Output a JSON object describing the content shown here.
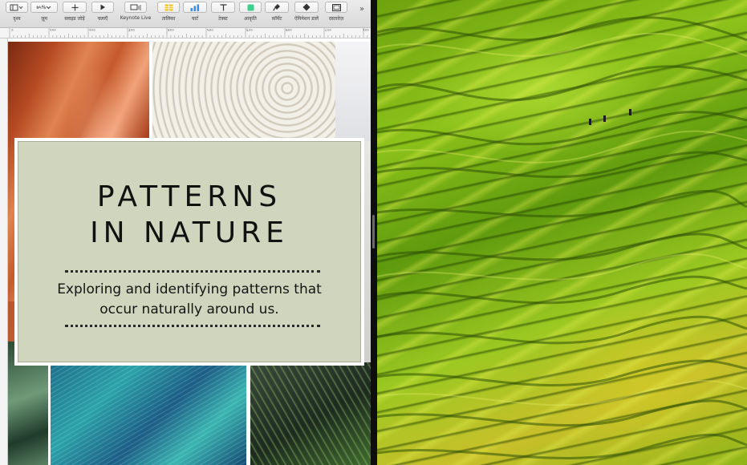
{
  "toolbar": {
    "items": [
      {
        "label": "दृश्य",
        "icon": "view-icon"
      },
      {
        "label": "ज़ूम",
        "value": "७५%",
        "icon": "zoom-icon"
      },
      {
        "label": "स्लाइड जोड़ें",
        "icon": "plus-icon"
      },
      {
        "label": "चलाएँ",
        "icon": "play-icon"
      },
      {
        "label": "Keynote Live",
        "icon": "keynote-live-icon"
      },
      {
        "label": "तालिका",
        "icon": "table-icon"
      },
      {
        "label": "चार्ट",
        "icon": "chart-icon"
      },
      {
        "label": "टेक्स्ट",
        "icon": "text-icon"
      },
      {
        "label": "आकृति",
        "icon": "shape-icon"
      },
      {
        "label": "फ़ॉर्मेट",
        "icon": "format-brush-icon"
      },
      {
        "label": "ऐनिमेशन डालें",
        "icon": "animate-diamond-icon"
      },
      {
        "label": "दस्तावेज़",
        "icon": "document-icon"
      }
    ],
    "more": "»"
  },
  "ruler": {
    "labels": [
      "०",
      "१००",
      "२००",
      "३००",
      "४००",
      "५००",
      "६००",
      "७००",
      "८००",
      "९००"
    ]
  },
  "slide": {
    "title_line1": "PATTERNS",
    "title_line2": "IN NATURE",
    "subtitle_line1": "Exploring and identifying patterns that",
    "subtitle_line2": "occur naturally around us."
  },
  "colors": {
    "title_card": "#d0d5bd",
    "toolbar_bg": "#e5e5e5",
    "table_icon": "#f0c419",
    "chart_icon": "#3b8fe0",
    "shape_icon": "#3ccf8e",
    "terrace_green": "#8cc21a"
  }
}
